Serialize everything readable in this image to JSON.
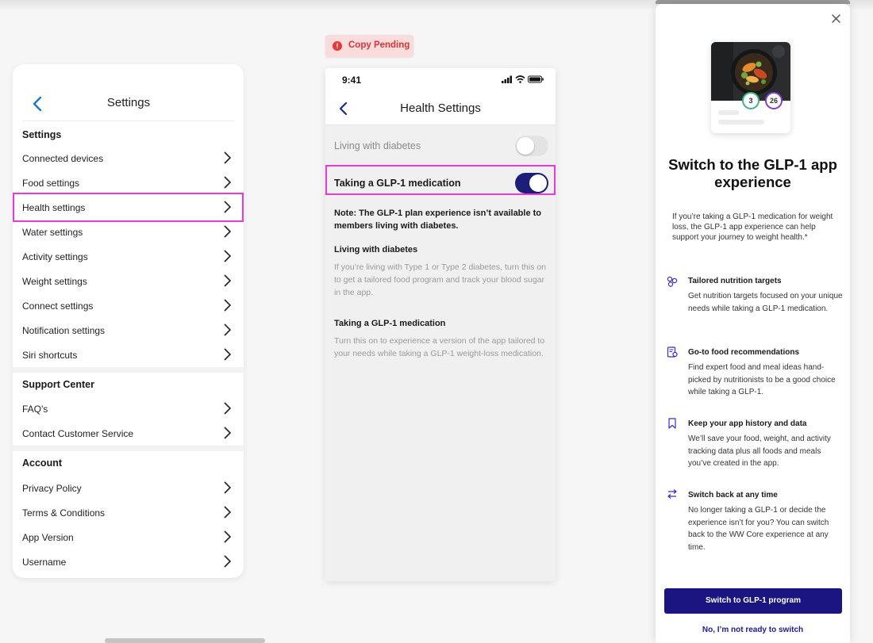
{
  "left_panel": {
    "title": "Settings",
    "section_settings": "Settings",
    "settings_items": [
      {
        "label": "Connected devices"
      },
      {
        "label": "Food settings"
      },
      {
        "label": "Health settings"
      },
      {
        "label": "Water settings"
      },
      {
        "label": "Activity settings"
      },
      {
        "label": "Weight settings"
      },
      {
        "label": "Connect settings"
      },
      {
        "label": "Notification settings"
      },
      {
        "label": "Siri shortcuts"
      }
    ],
    "section_support": "Support Center",
    "support_items": [
      {
        "label": "FAQ's"
      },
      {
        "label": "Contact Customer Service"
      }
    ],
    "section_account": "Account",
    "account_items": [
      {
        "label": "Privacy Policy"
      },
      {
        "label": "Terms & Conditions"
      },
      {
        "label": "App Version"
      },
      {
        "label": "Username"
      }
    ]
  },
  "badge": {
    "icon": "!",
    "label": "Copy Pending"
  },
  "phone": {
    "time": "9:41",
    "title": "Health Settings",
    "toggles": [
      {
        "label": "Living with diabetes",
        "on": false
      },
      {
        "label": "Taking a GLP-1 medication",
        "on": true
      }
    ],
    "note": "Note: The GLP-1 plan experience isn’t available to members living with diabetes.",
    "sections": [
      {
        "heading": "Living with diabetes",
        "body": "If you’re living with Type 1 or Type 2 diabetes, turn this on to get a tailored food program and track your blood sugar in the app."
      },
      {
        "heading": "Taking a GLP-1 medication",
        "body": "Turn this on to experience a version of the app tailored to your needs while taking a GLP-1 weight-loss medication."
      }
    ]
  },
  "modal": {
    "hero_badges": [
      "3",
      "26"
    ],
    "title": "Switch to the GLP-1 app experience",
    "intro": "If you’re taking a GLP-1 medication for weight loss, the GLP-1 app experience can help support your journey to weight health.*",
    "features": [
      {
        "icon": "nutrition-icon",
        "title": "Tailored nutrition targets",
        "body": "Get nutrition targets focused on your unique needs while taking a GLP-1 medication."
      },
      {
        "icon": "recipe-icon",
        "title": "Go-to food recommendations",
        "body": "Find expert food and meal ideas hand-picked by nutritionists to be a good choice while taking a GLP-1."
      },
      {
        "icon": "bookmark-icon",
        "title": "Keep your app history and data",
        "body": "We’ll save your food, weight, and activity tracking data plus all foods and meals you’ve created in the app."
      },
      {
        "icon": "switch-arrows-icon",
        "title": "Switch back at any time",
        "body": "No longer taking a GLP-1 or decide the experience isn’t for you? You can switch back to the WW Core experience at any time."
      }
    ],
    "primary_button": "Switch to GLP-1 program",
    "secondary_link": "No, I’m not ready to switch"
  },
  "colors": {
    "accent_navy": "#1a1580",
    "highlight_pink": "#e63ad9",
    "toggle_on": "#1e1e7a",
    "warning_red": "#e23b3b"
  }
}
